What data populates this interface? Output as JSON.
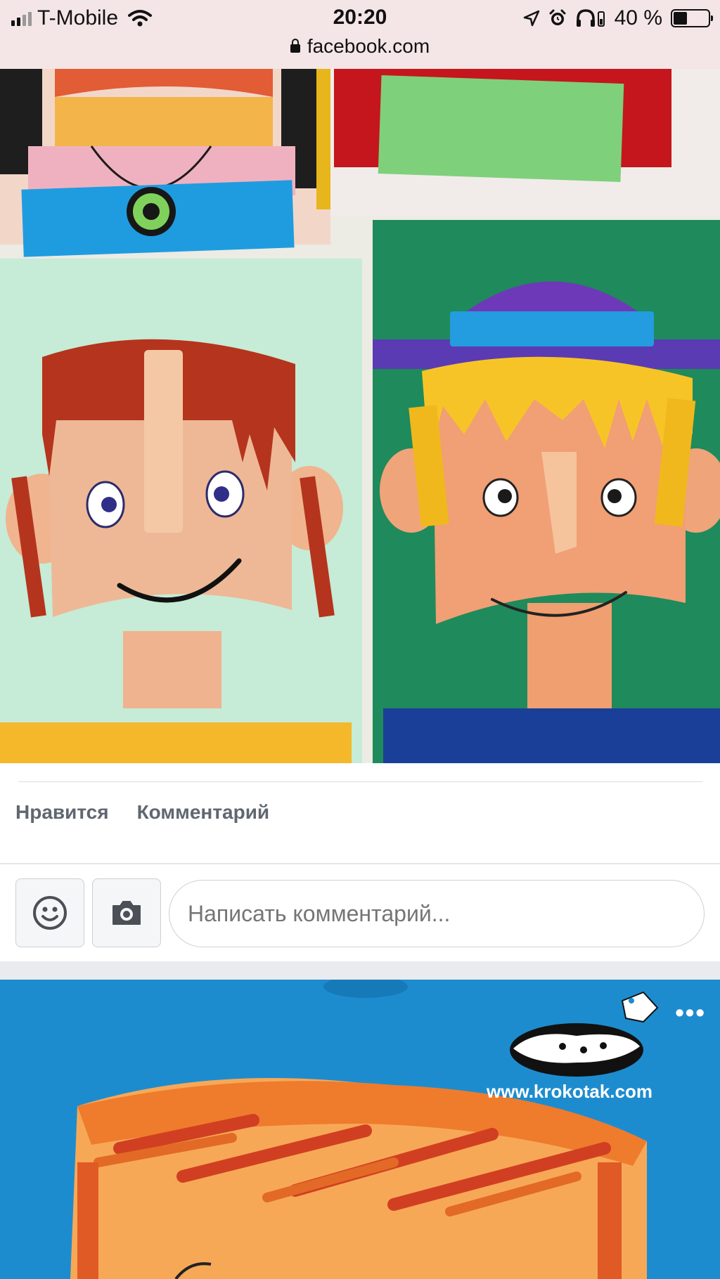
{
  "status_bar": {
    "carrier": "T-Mobile",
    "time": "20:20",
    "battery_text": "40 %",
    "battery_level": 0.4,
    "url": "facebook.com"
  },
  "post": {
    "actions": {
      "like_label": "Нравится",
      "comment_label": "Комментарий"
    }
  },
  "comment_bar": {
    "emoji_icon": "smiley-icon",
    "camera_icon": "camera-icon",
    "placeholder": "Написать комментарий..."
  },
  "next_post": {
    "watermark": "www.krokotak.com",
    "more_icon": "ellipsis-icon"
  },
  "colors": {
    "status_bg": "#f4e5e6",
    "action_text": "#606770",
    "separator": "#e9ebee",
    "blue_bg": "#1d8ccf"
  }
}
